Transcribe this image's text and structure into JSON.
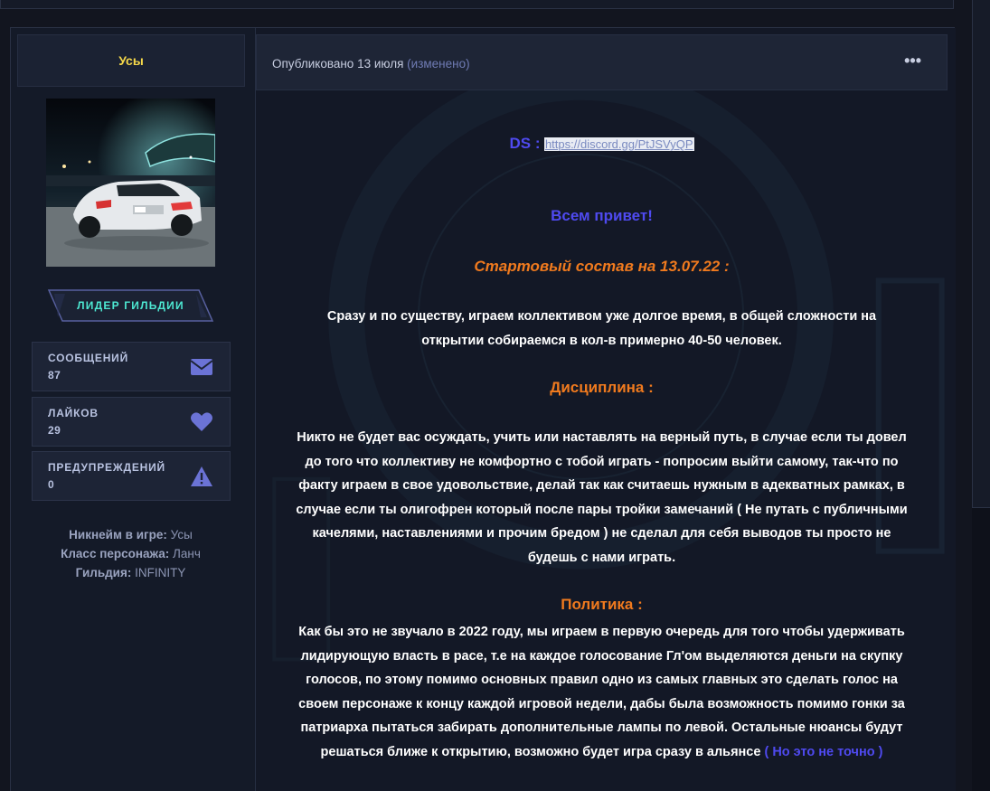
{
  "user": {
    "username": "Усы",
    "rank": "ЛИДЕР ГИЛЬДИИ"
  },
  "stats": [
    {
      "label": "СООБЩЕНИЙ",
      "value": "87",
      "icon": "envelope-icon"
    },
    {
      "label": "ЛАЙКОВ",
      "value": "29",
      "icon": "heart-icon"
    },
    {
      "label": "ПРЕДУПРЕЖДЕНИЙ",
      "value": "0",
      "icon": "warning-icon"
    }
  ],
  "info": {
    "nickname_label": "Никнейм в игре:",
    "nickname_value": "Усы",
    "class_label": "Класс персонажа:",
    "class_value": "Ланч",
    "guild_label": "Гильдия:",
    "guild_value": "INFINITY"
  },
  "meta": {
    "published": "Опубликовано 13 июля",
    "edited": "(изменено)",
    "more": "•••"
  },
  "post": {
    "ds_label": "DS :",
    "ds_link": "https://discord.gg/PtJSVyQP",
    "hello": "Всем привет!",
    "start": "Стартовый состав на 13.07.22 :",
    "p1_l1": "Сразу и по существу, играем коллективом уже долгое время, в общей сложности на",
    "p1_l2": "открытии собираемся в кол-в примерно 40-50 человек.",
    "discipline": "Дисциплина :",
    "p2_l1": "Никто не будет вас осуждать, учить или наставлять на верный путь, в случае если ты довел",
    "p2_l2": "до того что коллективу не комфортно с тобой играть - попросим выйти самому, так-что по",
    "p2_l3": "факту играем в свое удовольствие, делай так как считаешь нужным в адекватных рамках, в",
    "p2_l4": "случае если ты олигофрен который после пары тройки замечаний ( Не путать с публичными",
    "p2_l5": "качелями, наставлениями и прочим бредом ) не сделал для себя выводов ты просто не",
    "p2_l6": "будешь с нами играть.",
    "politics": "Политика :",
    "p3_l1": "Как бы это не звучало в 2022 году, мы играем в первую очередь для того чтобы удерживать",
    "p3_l2": "лидирующую власть в расе, т.е на каждое голосование Гл'ом выделяются деньги на скупку",
    "p3_l3": "голосов, по этому помимо основных правил одно  из самых главных это сделать голос на",
    "p3_l4": "своем персонаже к концу каждой игровой недели, дабы была возможность помимо гонки за",
    "p3_l5": "патриарха пытаться забирать дополнительные лампы по левой. Остальные нюансы будут",
    "p3_l6": "решаться ближе к открытию, возможно будет игра сразу в альянсе",
    "p3_note": "( Но это не точно )"
  },
  "colors": {
    "username": "#f5d84a",
    "rank": "#4de8d2",
    "heading_blue": "#4f4af0",
    "heading_orange": "#f07a1e",
    "background": "#12151f"
  }
}
